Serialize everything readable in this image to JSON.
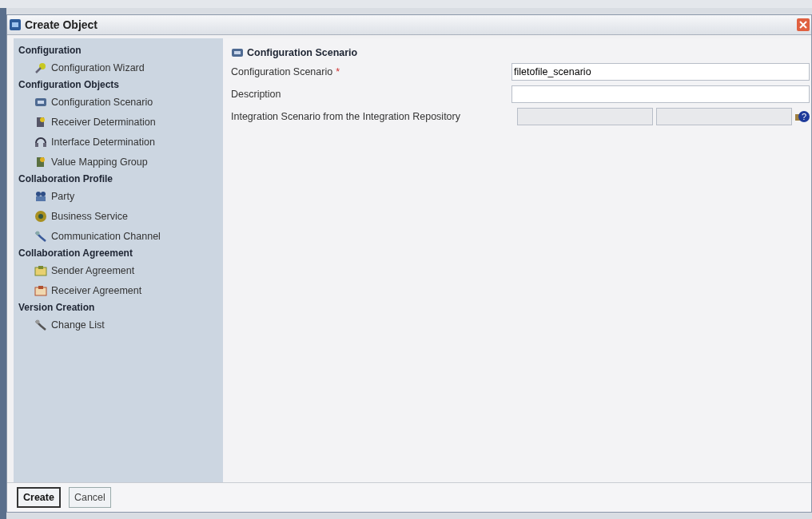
{
  "window": {
    "title": "Create Object"
  },
  "sidebar": {
    "sections": [
      {
        "title": "Configuration",
        "items": [
          {
            "label": "Configuration Wizard"
          }
        ]
      },
      {
        "title": "Configuration Objects",
        "items": [
          {
            "label": "Configuration Scenario"
          },
          {
            "label": "Receiver Determination"
          },
          {
            "label": "Interface Determination"
          },
          {
            "label": "Value Mapping Group"
          }
        ]
      },
      {
        "title": "Collaboration Profile",
        "items": [
          {
            "label": "Party"
          },
          {
            "label": "Business Service"
          },
          {
            "label": "Communication Channel"
          }
        ]
      },
      {
        "title": "Collaboration Agreement",
        "items": [
          {
            "label": "Sender Agreement"
          },
          {
            "label": "Receiver Agreement"
          }
        ]
      },
      {
        "title": "Version Creation",
        "items": [
          {
            "label": "Change List"
          }
        ]
      }
    ]
  },
  "form": {
    "heading": "Configuration Scenario",
    "required_mark": "*",
    "help_mark": "?",
    "fields": [
      {
        "kind": "text",
        "label": "Configuration Scenario",
        "required": true,
        "value": "filetofile_scenario"
      },
      {
        "kind": "text",
        "label": "Description",
        "required": false
      },
      {
        "kind": "pair",
        "label": "Integration Scenario from the Integration Repository",
        "required": false,
        "disabled": true
      }
    ]
  },
  "buttons": [
    {
      "label": "Create",
      "default": true
    },
    {
      "label": "Cancel",
      "default": false
    }
  ]
}
